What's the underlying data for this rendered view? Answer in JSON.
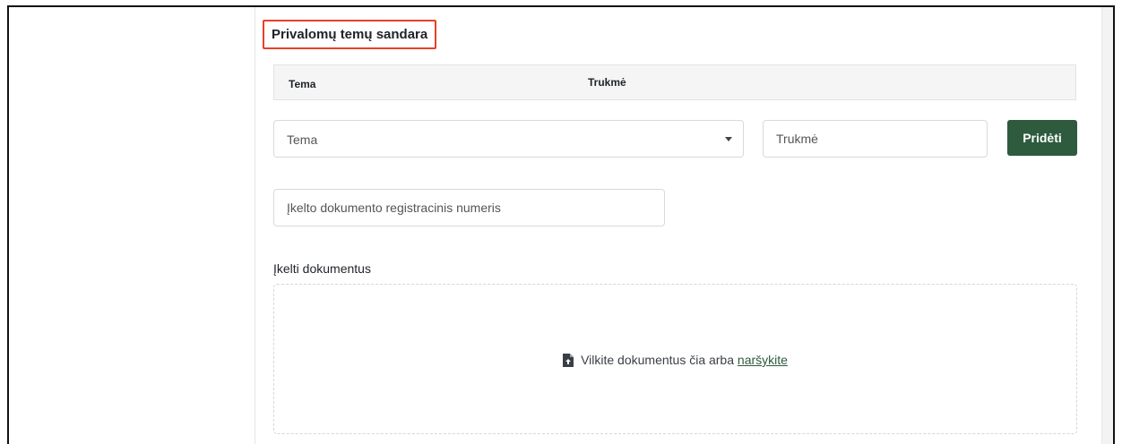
{
  "section": {
    "title": "Privalomų temų sandara"
  },
  "table": {
    "columns": [
      "Tema",
      "Trukmė"
    ]
  },
  "form": {
    "topic_select": {
      "placeholder": "Tema"
    },
    "duration_input": {
      "placeholder": "Trukmė"
    },
    "add_button_label": "Pridėti",
    "registration_input": {
      "placeholder": "Įkelto dokumento registracinis numeris"
    }
  },
  "upload": {
    "label": "Įkelti dokumentus",
    "drop_text": "Vilkite dokumentus čia arba ",
    "browse_link": "naršykite",
    "icon": "file-upload-icon"
  },
  "colors": {
    "accent_green": "#2e5a3e",
    "highlight_red": "#e8402a",
    "table_header_bg": "#f5f5f5"
  }
}
